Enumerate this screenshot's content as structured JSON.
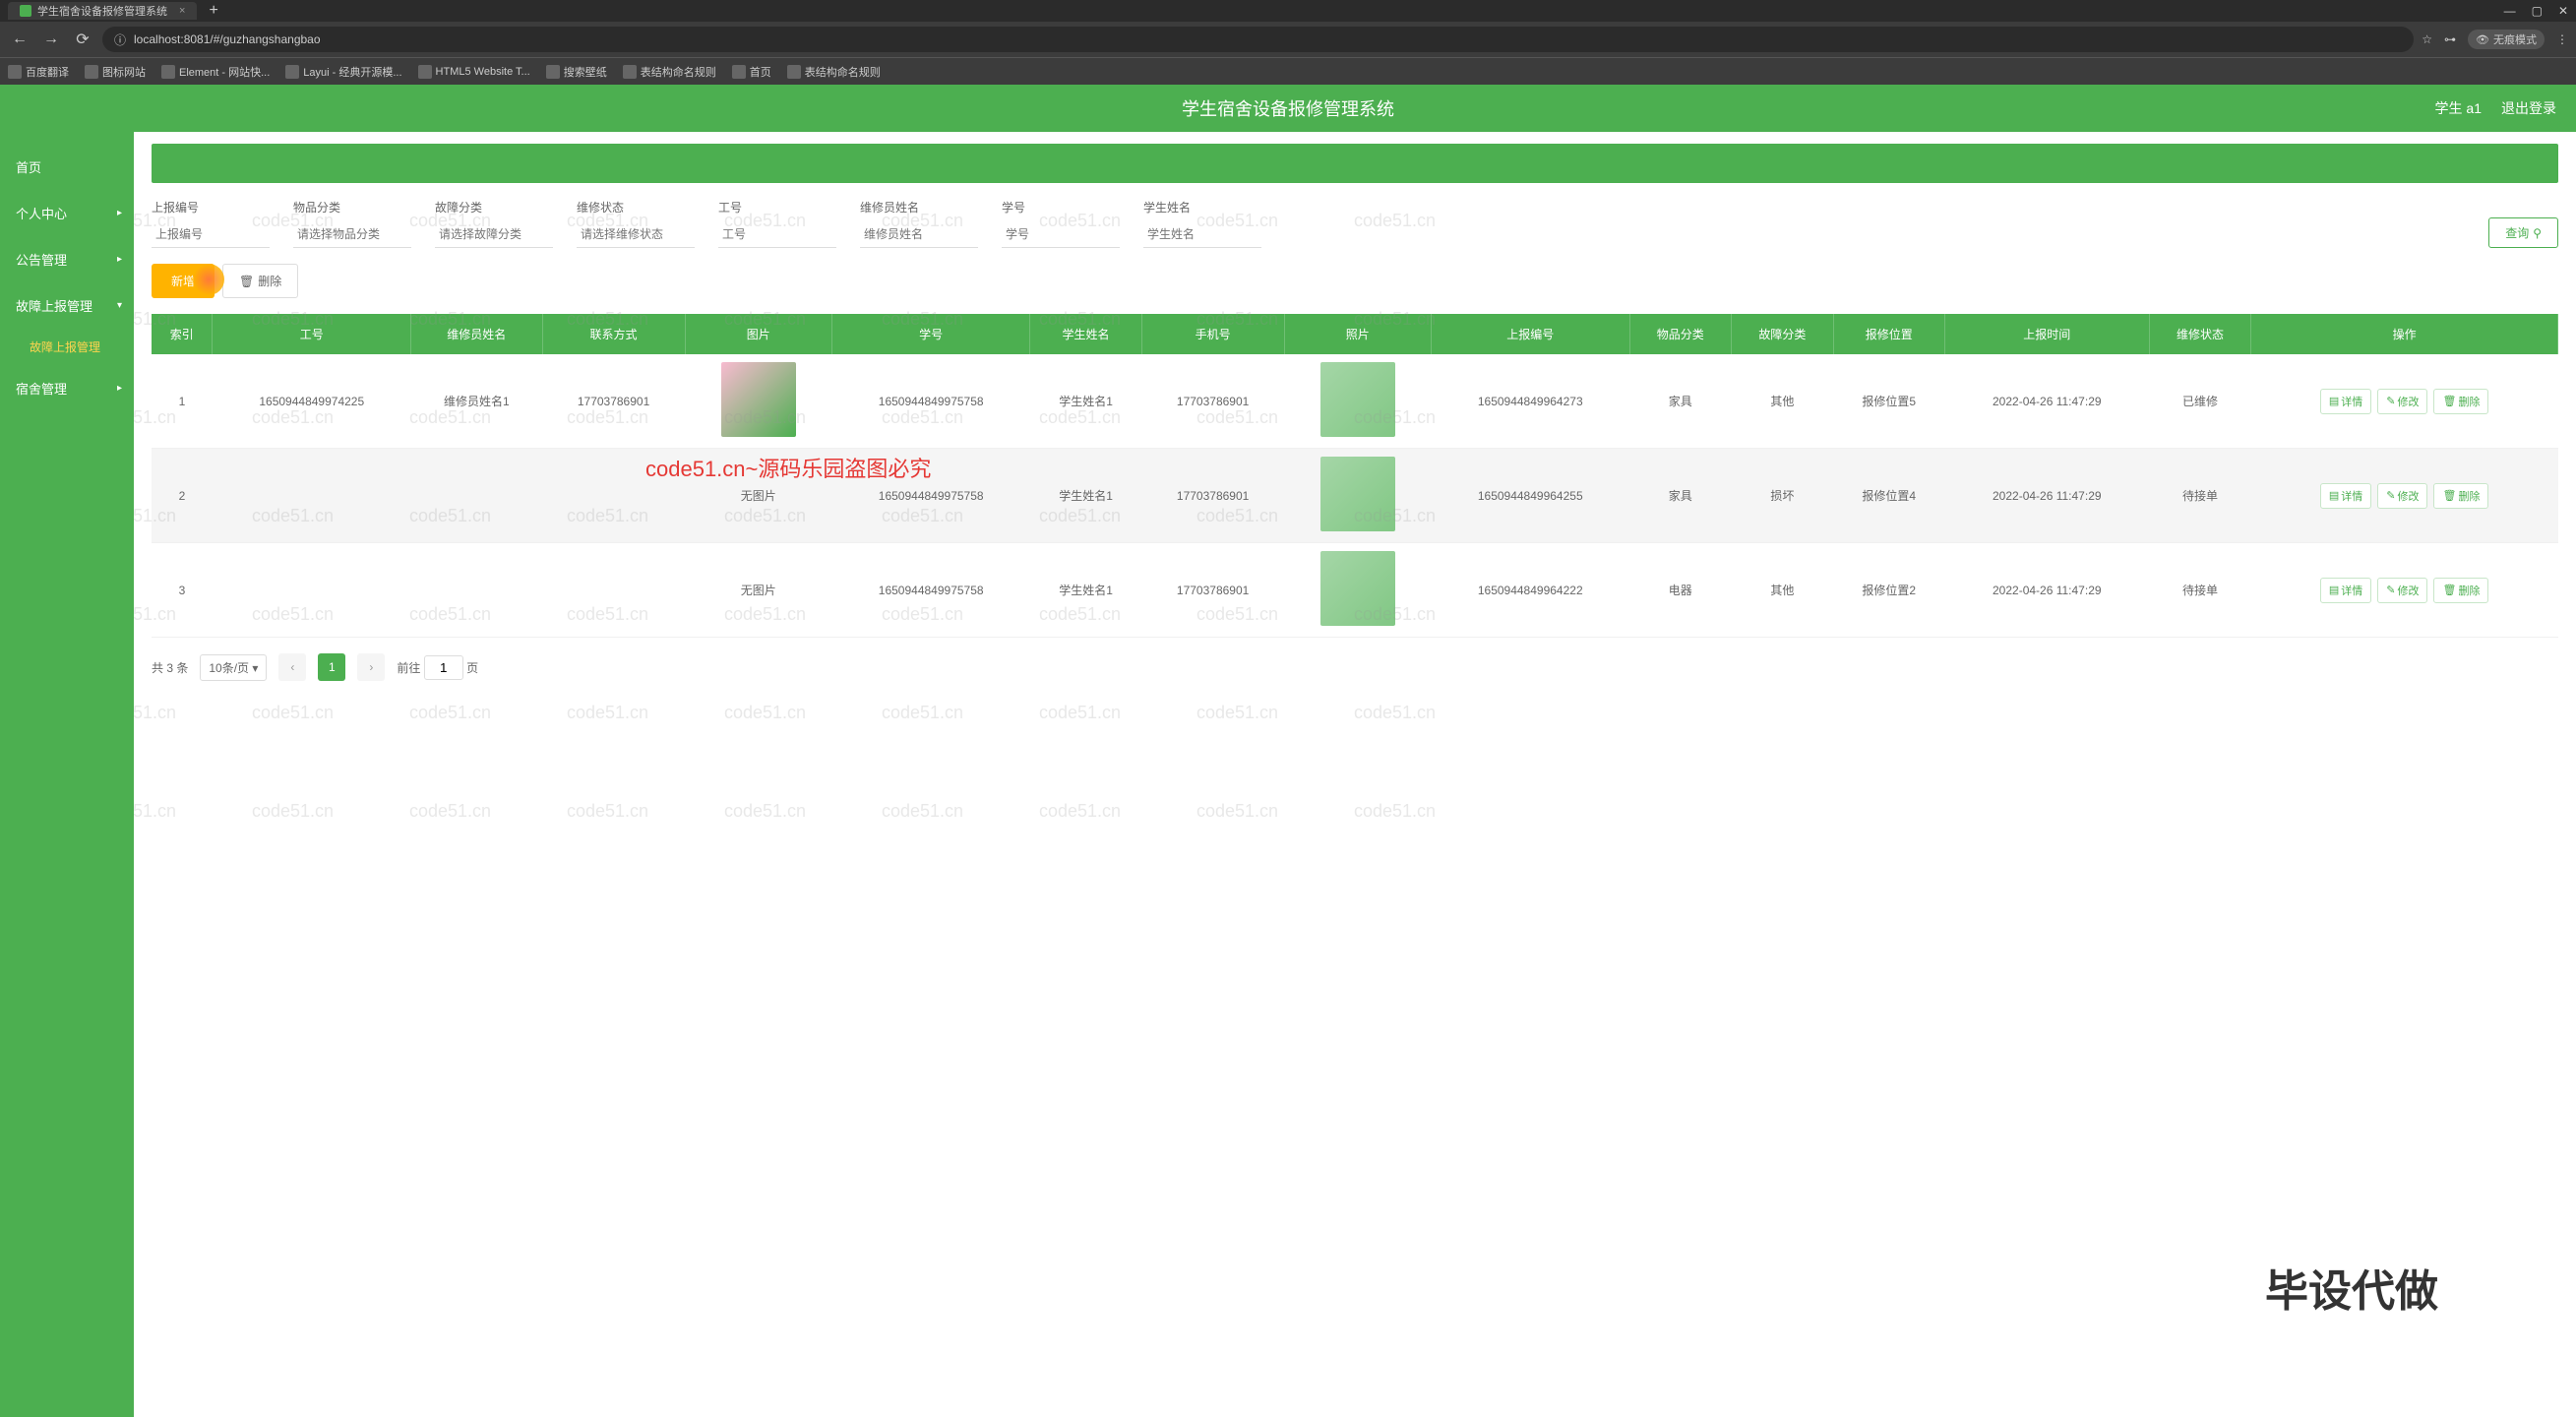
{
  "browser": {
    "tab_title": "学生宿舍设备报修管理系统",
    "url": "localhost:8081/#/guzhangshangbao",
    "incognito": "无痕模式",
    "bookmarks": [
      "百度翻译",
      "图标网站",
      "Element - 网站快...",
      "Layui - 经典开源模...",
      "HTML5 Website T...",
      "搜索壁纸",
      "表结构命名规则",
      "首页",
      "表结构命名规则"
    ]
  },
  "header": {
    "title": "学生宿舍设备报修管理系统",
    "user": "学生 a1",
    "logout": "退出登录"
  },
  "sidebar": {
    "items": [
      {
        "label": "首页",
        "sub": false
      },
      {
        "label": "个人中心",
        "sub": true
      },
      {
        "label": "公告管理",
        "sub": true
      },
      {
        "label": "故障上报管理",
        "sub": true,
        "expanded": true,
        "children": [
          "故障上报管理"
        ]
      },
      {
        "label": "宿舍管理",
        "sub": true
      }
    ]
  },
  "filters": {
    "labels": {
      "report_no": "上报编号",
      "item_cat": "物品分类",
      "fault_cat": "故障分类",
      "repair_status": "维修状态",
      "worker_no": "工号",
      "worker_name": "维修员姓名",
      "student_no": "学号",
      "student_name": "学生姓名"
    },
    "placeholders": {
      "report_no": "上报编号",
      "item_cat": "请选择物品分类",
      "fault_cat": "请选择故障分类",
      "repair_status": "请选择维修状态",
      "worker_no": "工号",
      "worker_name": "维修员姓名",
      "student_no": "学号",
      "student_name": "学生姓名"
    },
    "query_btn": "查询"
  },
  "actions": {
    "add": "新增",
    "delete": "删除"
  },
  "table": {
    "headers": [
      "索引",
      "工号",
      "维修员姓名",
      "联系方式",
      "图片",
      "学号",
      "学生姓名",
      "手机号",
      "照片",
      "上报编号",
      "物品分类",
      "故障分类",
      "报修位置",
      "上报时间",
      "维修状态",
      "操作"
    ],
    "rows": [
      {
        "idx": "1",
        "worker_no": "1650944849974225",
        "worker_name": "维修员姓名1",
        "contact": "17703786901",
        "img": "p1",
        "student_no": "1650944849975758",
        "student_name": "学生姓名1",
        "phone": "17703786901",
        "photo": "p2",
        "report_no": "1650944849964273",
        "item_cat": "家具",
        "fault_cat": "其他",
        "loc": "报修位置5",
        "time": "2022-04-26 11:47:29",
        "status": "已维修"
      },
      {
        "idx": "2",
        "worker_no": "",
        "worker_name": "",
        "contact": "",
        "img": "无图片",
        "student_no": "1650944849975758",
        "student_name": "学生姓名1",
        "phone": "17703786901",
        "photo": "p2",
        "report_no": "1650944849964255",
        "item_cat": "家具",
        "fault_cat": "损坏",
        "loc": "报修位置4",
        "time": "2022-04-26 11:47:29",
        "status": "待接单"
      },
      {
        "idx": "3",
        "worker_no": "",
        "worker_name": "",
        "contact": "",
        "img": "无图片",
        "student_no": "1650944849975758",
        "student_name": "学生姓名1",
        "phone": "17703786901",
        "photo": "p2",
        "report_no": "1650944849964222",
        "item_cat": "电器",
        "fault_cat": "其他",
        "loc": "报修位置2",
        "time": "2022-04-26 11:47:29",
        "status": "待接单"
      }
    ],
    "ops": {
      "detail": "详情",
      "edit": "修改",
      "del": "删除"
    }
  },
  "pagination": {
    "total": "共 3 条",
    "page_size": "10条/页",
    "current": "1",
    "goto": "前往",
    "page": "页"
  },
  "watermarks": {
    "repeat": "code51.cn",
    "red": "code51.cn~源码乐园盗图必究",
    "big": "毕设代做"
  }
}
